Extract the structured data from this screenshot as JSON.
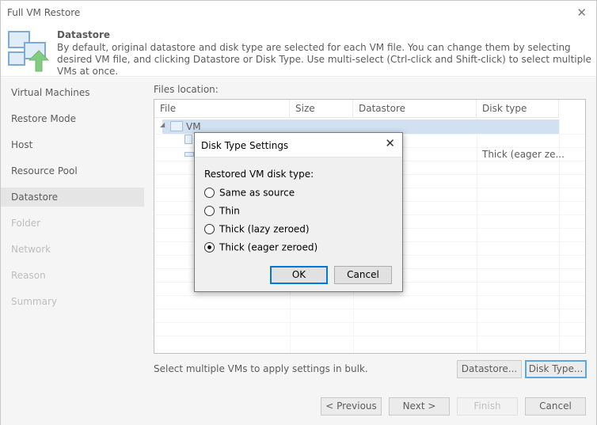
{
  "window": {
    "title": "Full VM Restore",
    "close_glyph": "✕"
  },
  "header": {
    "title": "Datastore",
    "description": "By default, original datastore and disk type are selected for each VM file. You can change them by selecting desired VM file, and clicking Datastore or Disk Type. Use multi-select (Ctrl-click and Shift-click) to select multiple VMs at once.",
    "icon": "datastore-upload-icon"
  },
  "sidebar": {
    "items": [
      {
        "label": "Virtual Machines",
        "state": "normal"
      },
      {
        "label": "Restore Mode",
        "state": "normal"
      },
      {
        "label": "Host",
        "state": "normal"
      },
      {
        "label": "Resource Pool",
        "state": "normal"
      },
      {
        "label": "Datastore",
        "state": "active"
      },
      {
        "label": "Folder",
        "state": "disabled"
      },
      {
        "label": "Network",
        "state": "disabled"
      },
      {
        "label": "Reason",
        "state": "disabled"
      },
      {
        "label": "Summary",
        "state": "disabled"
      }
    ]
  },
  "files": {
    "label": "Files location:",
    "columns": [
      "File",
      "Size",
      "Datastore",
      "Disk type"
    ],
    "vm_name": "VM",
    "expander_glyph": "◢",
    "disk_type_value": "Thick (eager ze..."
  },
  "bulk": {
    "text": "Select multiple VMs to apply settings in bulk.",
    "datastore_button": "Datastore...",
    "disk_type_button": "Disk Type..."
  },
  "footer": {
    "previous": "< Previous",
    "next": "Next >",
    "finish": "Finish",
    "cancel": "Cancel"
  },
  "dialog": {
    "title": "Disk Type Settings",
    "close_glyph": "✕",
    "label": "Restored VM disk type:",
    "options": [
      {
        "label": "Same as source",
        "checked": false
      },
      {
        "label": "Thin",
        "checked": false
      },
      {
        "label": "Thick (lazy zeroed)",
        "checked": false
      },
      {
        "label": "Thick (eager zeroed)",
        "checked": true
      }
    ],
    "ok": "OK",
    "cancel": "Cancel"
  }
}
